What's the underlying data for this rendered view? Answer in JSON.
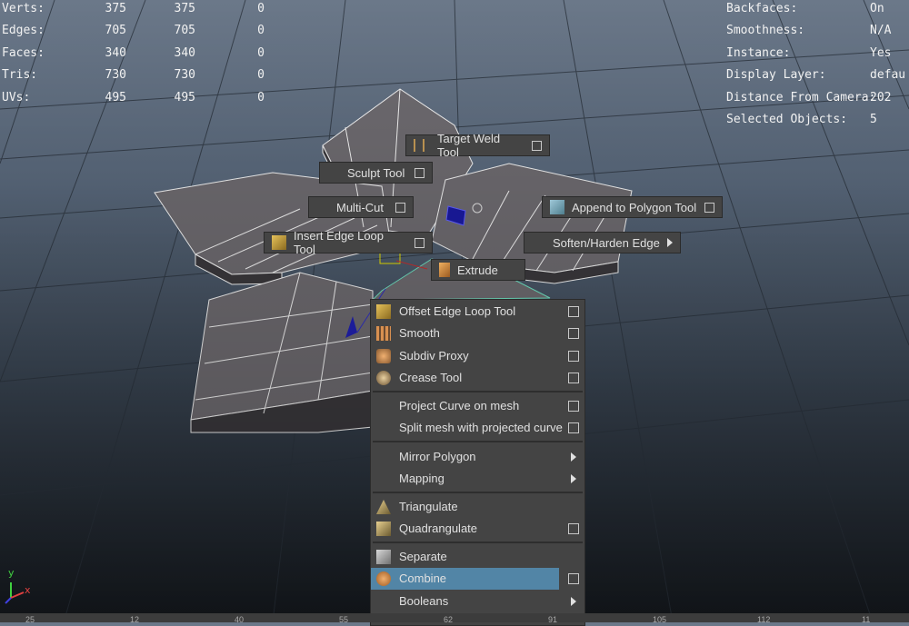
{
  "hud_left": [
    {
      "label": "Verts:",
      "v1": "375",
      "v2": "375",
      "v3": "0"
    },
    {
      "label": "Edges:",
      "v1": "705",
      "v2": "705",
      "v3": "0"
    },
    {
      "label": "Faces:",
      "v1": "340",
      "v2": "340",
      "v3": "0"
    },
    {
      "label": "Tris:",
      "v1": "730",
      "v2": "730",
      "v3": "0"
    },
    {
      "label": "UVs:",
      "v1": "495",
      "v2": "495",
      "v3": "0"
    }
  ],
  "hud_right": [
    {
      "label": "Backfaces:",
      "value": "On"
    },
    {
      "label": "Smoothness:",
      "value": "N/A"
    },
    {
      "label": "Instance:",
      "value": "Yes"
    },
    {
      "label": "Display Layer:",
      "value": "defau"
    },
    {
      "label": "Distance From Camera:",
      "value": "202"
    },
    {
      "label": "Selected Objects:",
      "value": "5"
    }
  ],
  "marking_menu": {
    "target_weld": "Target Weld Tool",
    "sculpt": "Sculpt Tool",
    "multi_cut": "Multi-Cut",
    "append_polygon": "Append to Polygon Tool",
    "insert_edge_loop": "Insert Edge Loop Tool",
    "soften_harden": "Soften/Harden Edge",
    "extrude": "Extrude"
  },
  "context_menu": {
    "offset_edge_loop": "Offset Edge Loop Tool",
    "smooth": "Smooth",
    "subdiv_proxy": "Subdiv Proxy",
    "crease": "Crease Tool",
    "project_curve": "Project Curve on mesh",
    "split_mesh": "Split mesh with projected curve",
    "mirror_polygon": "Mirror Polygon",
    "mapping": "Mapping",
    "triangulate": "Triangulate",
    "quadrangulate": "Quadrangulate",
    "separate": "Separate",
    "combine": "Combine",
    "booleans": "Booleans"
  },
  "axis": {
    "x": "x",
    "y": "y"
  },
  "timeline_ticks": [
    "25",
    "12",
    "40",
    "55",
    "62",
    "91",
    "105",
    "112",
    "11"
  ],
  "colors": {
    "menu_bg": "#444444",
    "highlight": "#5285a6",
    "mesh_face": "#6d6a6f",
    "wire": "#ffffff",
    "selection_wire": "#6fe0c0"
  }
}
